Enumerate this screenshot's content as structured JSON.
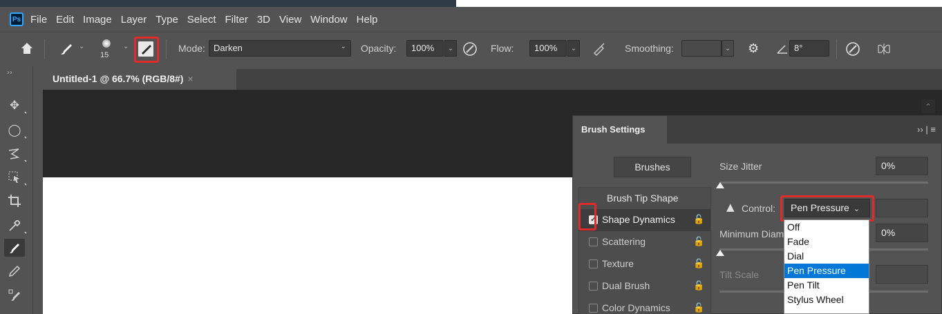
{
  "menubar": {
    "logo": "Ps",
    "items": [
      "File",
      "Edit",
      "Image",
      "Layer",
      "Type",
      "Select",
      "Filter",
      "3D",
      "View",
      "Window",
      "Help"
    ]
  },
  "options": {
    "home_icon": "home-icon",
    "brush_size": "15",
    "mode_label": "Mode:",
    "mode_value": "Darken",
    "opacity_label": "Opacity:",
    "opacity_value": "100%",
    "flow_label": "Flow:",
    "flow_value": "100%",
    "smoothing_label": "Smoothing:",
    "smoothing_value": "",
    "angle_value": "8°"
  },
  "document": {
    "tab_title": "Untitled-1 @ 66.7% (RGB/8#)",
    "close_glyph": "×"
  },
  "panel": {
    "title": "Brush Settings",
    "controls": "›› | ≡",
    "brushes_button": "Brushes",
    "list": [
      {
        "label": "Brush Tip Shape",
        "header": true
      },
      {
        "label": "Shape Dynamics",
        "checked": true
      },
      {
        "label": "Scattering",
        "checked": false
      },
      {
        "label": "Texture",
        "checked": false
      },
      {
        "label": "Dual Brush",
        "checked": false
      },
      {
        "label": "Color Dynamics",
        "checked": false
      }
    ],
    "size_jitter_label": "Size Jitter",
    "size_jitter_value": "0%",
    "control_label": "Control:",
    "control_value": "Pen Pressure",
    "min_diameter_label": "Minimum Diam",
    "min_diameter_value": "0%",
    "tilt_scale_label": "Tilt Scale"
  },
  "dropdown": {
    "options": [
      "Off",
      "Fade",
      "Dial",
      "Pen Pressure",
      "Pen Tilt",
      "Stylus Wheel"
    ],
    "selected": "Pen Pressure"
  },
  "colors": {
    "highlight_red": "#e12a2a",
    "selection_blue": "#0078d7"
  }
}
